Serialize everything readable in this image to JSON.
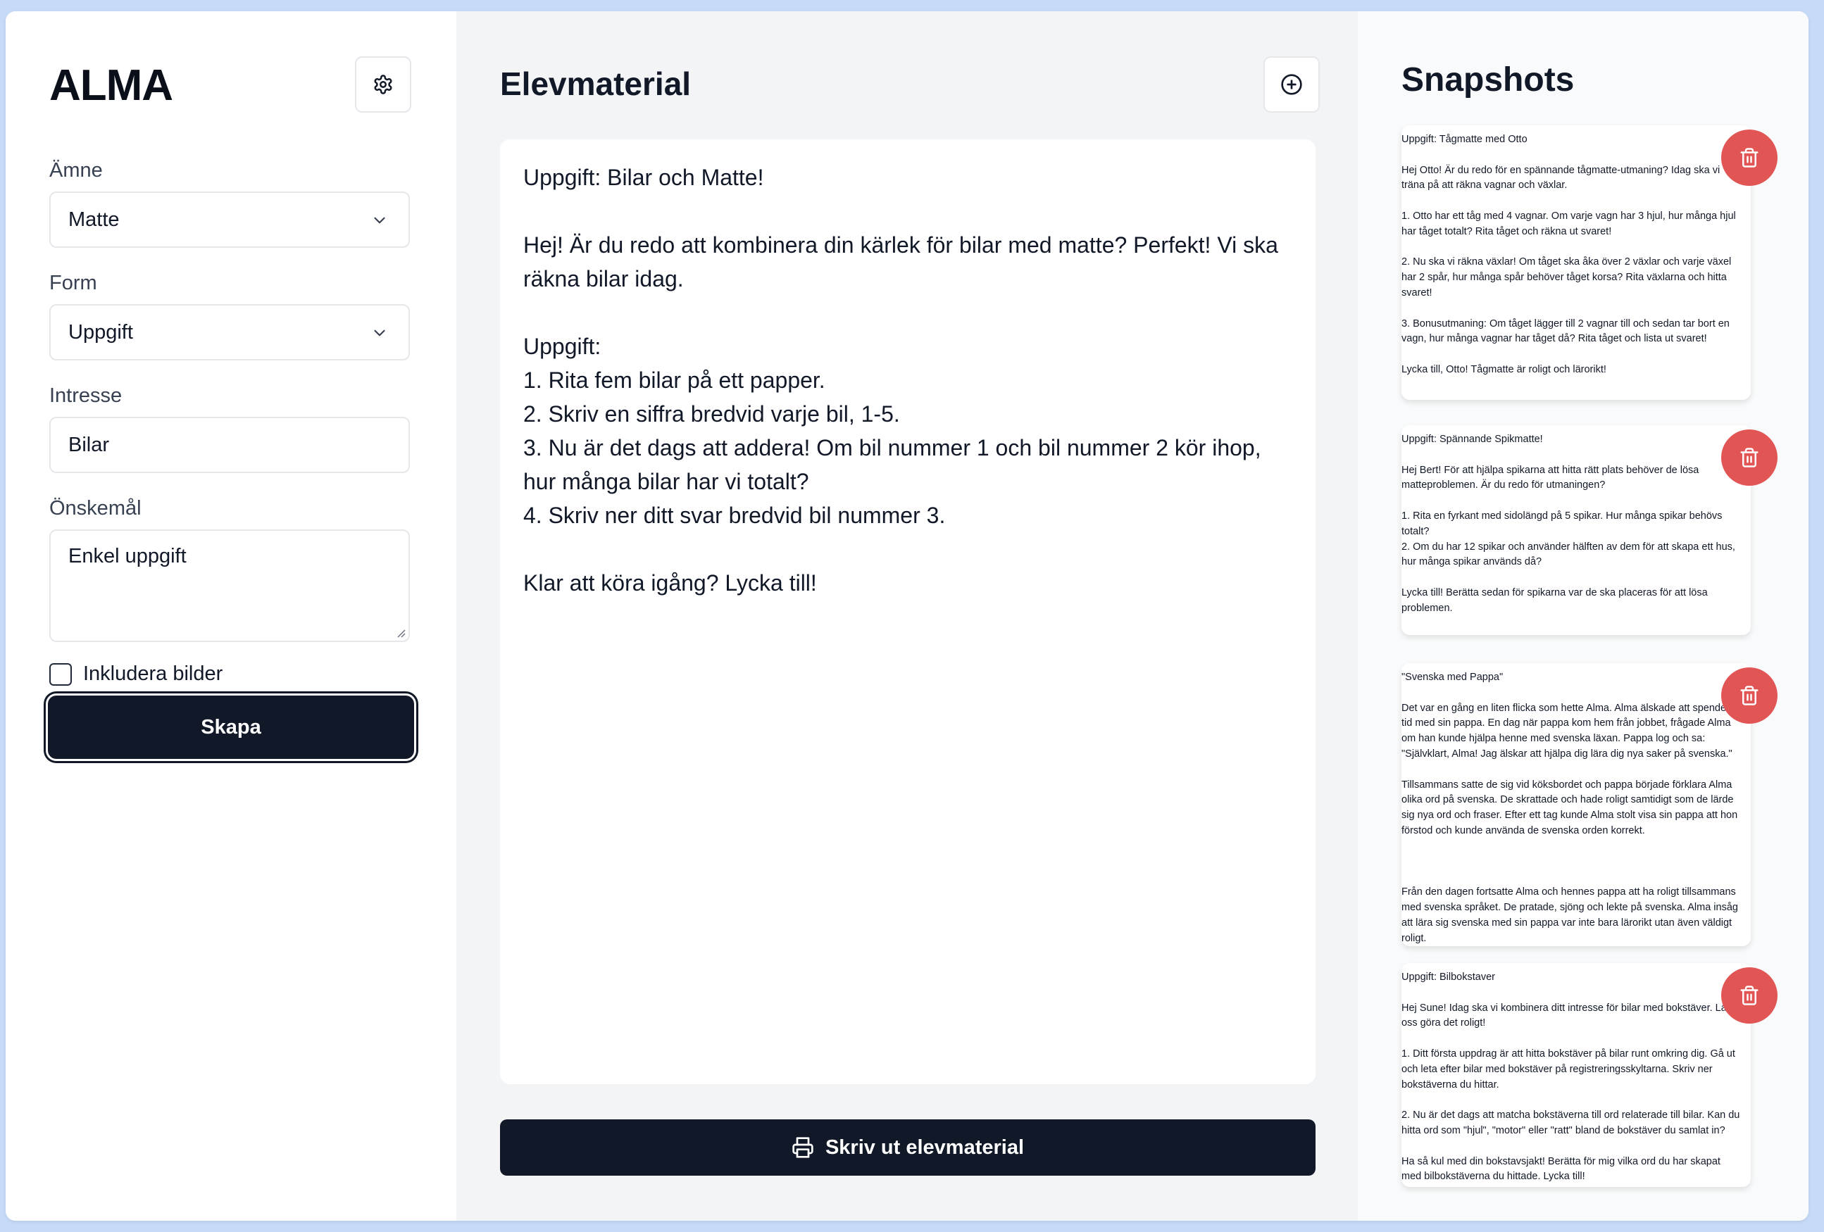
{
  "sidebar": {
    "brand": "ALMA",
    "subject": {
      "label": "Ämne",
      "value": "Matte"
    },
    "form": {
      "label": "Form",
      "value": "Uppgift"
    },
    "interest": {
      "label": "Intresse",
      "value": "Bilar"
    },
    "wishes": {
      "label": "Önskemål",
      "value": "Enkel uppgift"
    },
    "include_images": {
      "label": "Inkludera bilder",
      "checked": false
    },
    "create_label": "Skapa"
  },
  "main": {
    "title": "Elevmaterial",
    "content": "Uppgift: Bilar och Matte!\n\nHej! Är du redo att kombinera din kärlek för bilar med matte? Perfekt! Vi ska räkna bilar idag.\n\nUppgift:\n1. Rita fem bilar på ett papper.\n2. Skriv en siffra bredvid varje bil, 1-5.\n3. Nu är det dags att addera! Om bil nummer 1 och bil nummer 2 kör ihop, hur många bilar har vi totalt?\n4. Skriv ner ditt svar bredvid bil nummer 3.\n\nKlar att köra igång? Lycka till!",
    "print_label": "Skriv ut elevmaterial"
  },
  "snapshots": {
    "title": "Snapshots",
    "items": [
      {
        "text": "Uppgift: Tågmatte med Otto\n\nHej Otto! Är du redo för en spännande tågmatte-utmaning? Idag ska vi\nträna på att räkna vagnar och växlar.\n\n1. Otto har ett tåg med 4 vagnar. Om varje vagn har 3 hjul, hur många hjul\nhar tåget totalt? Rita tåget och räkna ut svaret!\n\n2. Nu ska vi räkna växlar! Om tåget ska åka över 2 växlar och varje växel\nhar 2 spår, hur många spår behöver tåget korsa? Rita växlarna och hitta\nsvaret!\n\n3. Bonusutmaning: Om tåget lägger till 2 vagnar till och sedan tar bort en\nvagn, hur många vagnar har tåget då? Rita tåget och lista ut svaret!\n\nLycka till, Otto! Tågmatte är roligt och lärorikt!"
      },
      {
        "text": "Uppgift: Spännande Spikmatte!\n\nHej Bert! För att hjälpa spikarna att hitta rätt plats behöver de lösa\nmatteproblemen. Är du redo för utmaningen?\n\n1. Rita en fyrkant med sidolängd på 5 spikar. Hur många spikar behövs\ntotalt?\n2. Om du har 12 spikar och använder hälften av dem för att skapa ett hus,\nhur många spikar används då?\n\nLycka till! Berätta sedan för spikarna var de ska placeras för att lösa\nproblemen."
      },
      {
        "text": "\"Svenska med Pappa\"\n\nDet var en gång en liten flicka som hette Alma. Alma älskade att spendera\ntid med sin pappa. En dag när pappa kom hem från jobbet, frågade Alma\nom han kunde hjälpa henne med svenska läxan. Pappa log och sa:\n\"Självklart, Alma! Jag älskar att hjälpa dig lära dig nya saker på svenska.\"\n\nTillsammans satte de sig vid köksbordet och pappa började förklara Alma\nolika ord på svenska. De skrattade och hade roligt samtidigt som de lärde\nsig nya ord och fraser. Efter ett tag kunde Alma stolt visa sin pappa att hon\nförstod och kunde använda de svenska orden korrekt.\n\n\n\nFrån den dagen fortsatte Alma och hennes pappa att ha roligt tillsammans\nmed svenska språket. De pratade, sjöng och lekte på svenska. Alma insåg\natt lära sig svenska med sin pappa var inte bara lärorikt utan även väldigt\nroligt."
      },
      {
        "text": "Uppgift: Bilbokstaver\n\nHej Sune! Idag ska vi kombinera ditt intresse för bilar med bokstäver. Låt\noss göra det roligt!\n\n1. Ditt första uppdrag är att hitta bokstäver på bilar runt omkring dig. Gå ut\noch leta efter bilar med bokstäver på registreringsskyltarna. Skriv ner\nbokstäverna du hittar.\n\n2. Nu är det dags att matcha bokstäverna till ord relaterade till bilar. Kan du\nhitta ord som \"hjul\", \"motor\" eller \"ratt\" bland de bokstäver du samlat in?\n\nHa så kul med din bokstavsjakt! Berätta för mig vilka ord du har skapat\nmed bilbokstäverna du hittade. Lycka till!"
      }
    ]
  },
  "colors": {
    "background": "#c5dbf7",
    "primary_button": "#111827",
    "delete_button": "#e25555",
    "main_panel": "#f3f4f6"
  },
  "icons": {
    "settings": "gear-icon",
    "add": "plus-circle-icon",
    "print": "printer-icon",
    "delete": "trash-icon",
    "dropdown": "chevron-down-icon"
  }
}
